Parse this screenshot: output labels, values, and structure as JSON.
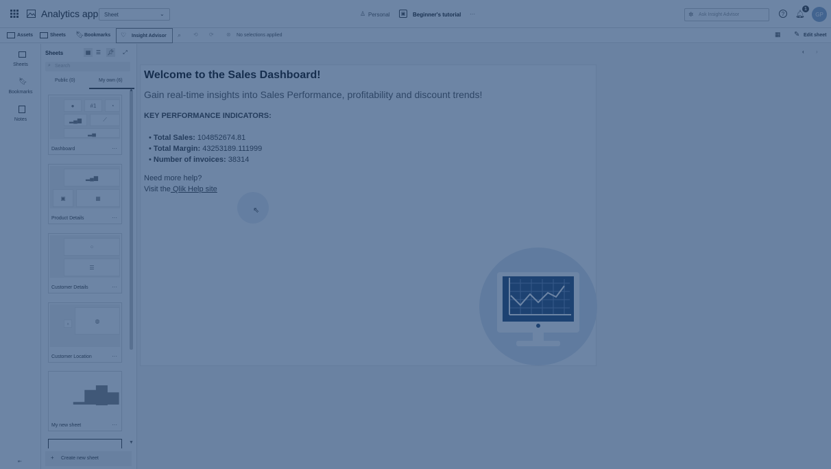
{
  "topbar": {
    "app_title": "Analytics app",
    "sheet_select": "Sheet",
    "space_label": "Personal",
    "tutorial_label": "Beginner's tutorial",
    "more_label": "···",
    "search_placeholder": "Ask Insight Advisor",
    "notification_count": "1",
    "avatar_initials": "GP"
  },
  "toolbar": {
    "assets": "Assets",
    "sheets": "Sheets",
    "bookmarks": "Bookmarks",
    "insight_advisor": "Insight Advisor",
    "no_selections": "No selections applied",
    "edit_sheet": "Edit sheet"
  },
  "leftrail": {
    "sheets": "Sheets",
    "bookmarks": "Bookmarks",
    "notes": "Notes"
  },
  "sheetpanel": {
    "title": "Sheets",
    "search_placeholder": "Search",
    "tabs": [
      "Public (0)",
      "My own (6)"
    ],
    "sheets": [
      "Dashboard",
      "Product Details",
      "Customer Details",
      "Customer Location",
      "My new sheet"
    ],
    "create_new": "Create new sheet"
  },
  "content": {
    "heading": "Welcome to the Sales Dashboard!",
    "subheading": "Gain real-time insights into Sales Performance, profitability and discount trends!",
    "kpi_heading": "KEY PERFORMANCE INDICATORS:",
    "kpis": [
      {
        "label": "Total Sales:",
        "value": "104852674.81"
      },
      {
        "label": "Total Margin:",
        "value": "43253189.111999"
      },
      {
        "label": "Number of invoices:",
        "value": "38314"
      }
    ],
    "help_line": "Need more help?",
    "visit_prefix": "Visit the",
    "help_link": " Qlik Help site"
  },
  "colors": {
    "overlay": "#133a6e",
    "accent": "#009845"
  }
}
